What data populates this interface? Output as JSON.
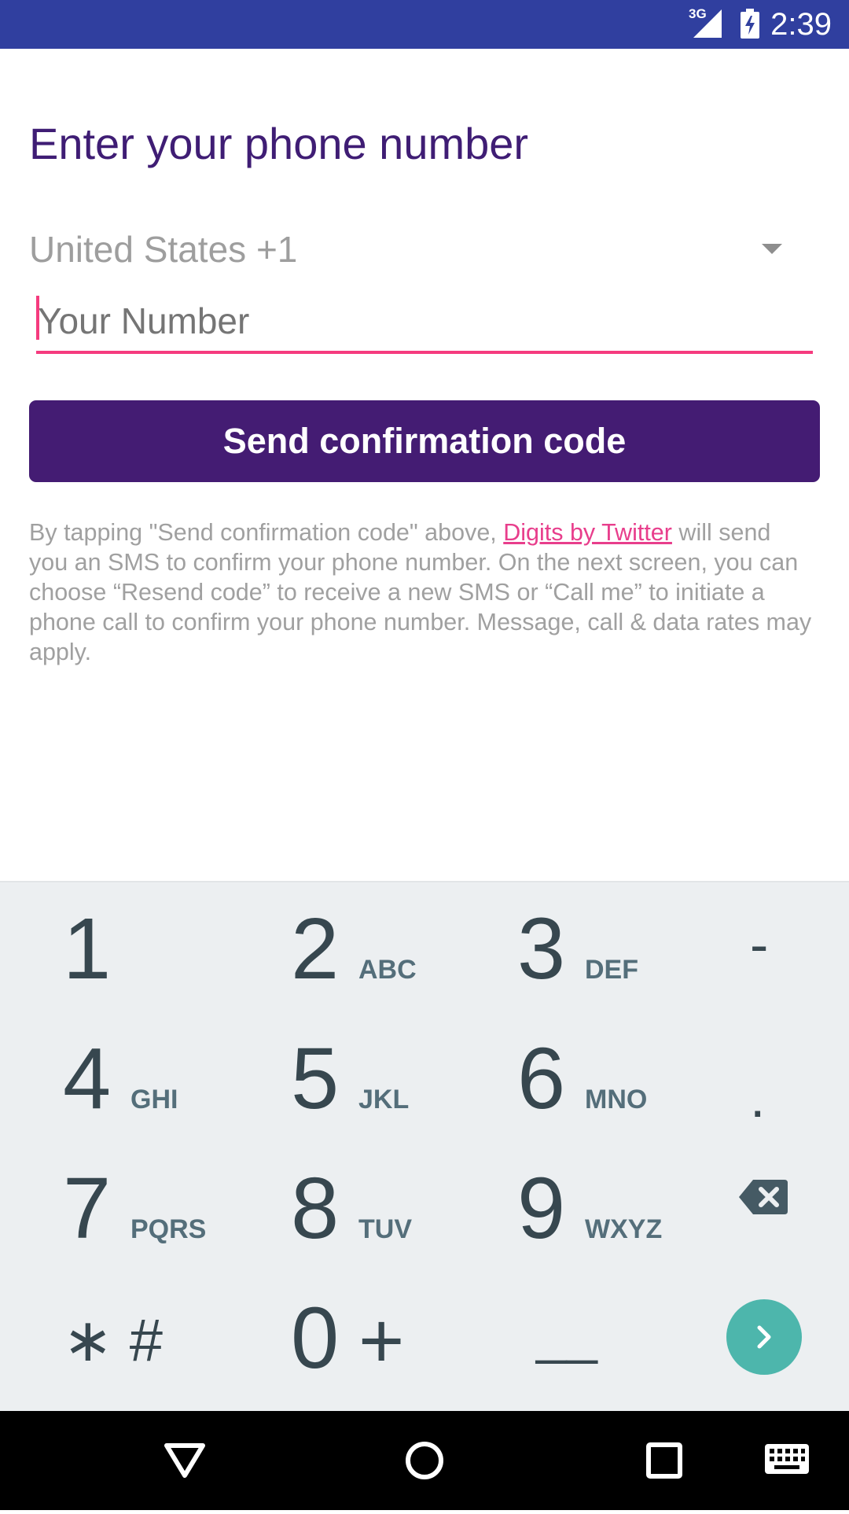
{
  "status_bar": {
    "network": "3G",
    "time": "2:39"
  },
  "form": {
    "title": "Enter your phone number",
    "country": "United States +1",
    "phone_placeholder": "Your Number",
    "phone_value": "",
    "send_button_label": "Send confirmation code"
  },
  "disclaimer": {
    "before_link": "By tapping \"Send confirmation code\" above, ",
    "link_text": "Digits by Twitter",
    "after_link": " will send you an SMS to confirm your phone number. On the next screen, you can choose “Resend code” to receive a new SMS or “Call me” to initiate a phone call to confirm your phone number. Message, call & data rates may apply."
  },
  "keypad": {
    "keys": [
      {
        "digit": "1",
        "letters": ""
      },
      {
        "digit": "2",
        "letters": "ABC"
      },
      {
        "digit": "3",
        "letters": "DEF"
      },
      {
        "digit": "4",
        "letters": "GHI"
      },
      {
        "digit": "5",
        "letters": "JKL"
      },
      {
        "digit": "6",
        "letters": "MNO"
      },
      {
        "digit": "7",
        "letters": "PQRS"
      },
      {
        "digit": "8",
        "letters": "TUV"
      },
      {
        "digit": "9",
        "letters": "WXYZ"
      },
      {
        "digit": "0",
        "letters": ""
      }
    ],
    "dash": "-",
    "dot": ".",
    "star_hash": "∗ #",
    "plus": "+",
    "underscore": "__",
    "backspace_icon": "backspace-icon",
    "next_icon": "chevron-right-icon"
  },
  "nav_bar": {
    "back_icon": "back-triangle-icon",
    "home_icon": "home-circle-icon",
    "recents_icon": "recents-square-icon",
    "keyboard_icon": "keyboard-icon"
  },
  "colors": {
    "status_bar": "#303F9F",
    "title": "#3F1D74",
    "button": "#441C73",
    "accent": "#F53B7E",
    "link": "#E83E8C",
    "keypad_bg": "#ECEFF1",
    "next_button": "#4DB6AC"
  }
}
